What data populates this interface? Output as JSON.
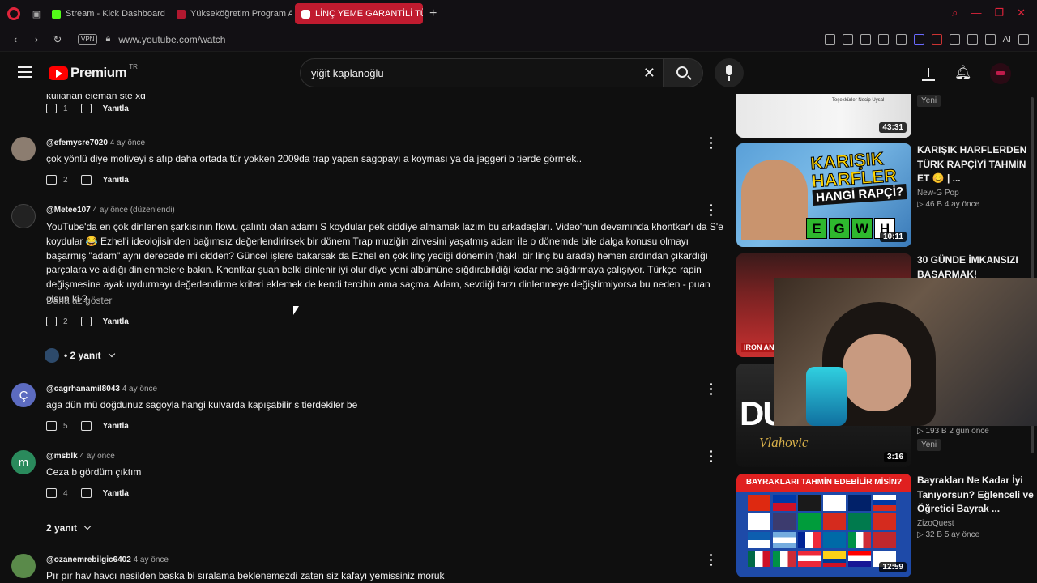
{
  "browser": {
    "tabs": [
      {
        "label": "Stream - Kick Dashboard",
        "fav_color": "#53fc18"
      },
      {
        "label": "Yükseköğretim Program Atlası",
        "fav_color": "#b1182f"
      },
      {
        "label": "LİNÇ YEME GARANTİLİ TÜRK",
        "fav_color": "#ffffff",
        "active": true
      }
    ],
    "url": "www.youtube.com/watch",
    "vpn": "VPN",
    "ai_label": "AI"
  },
  "header": {
    "logo_word": "Premium",
    "region": "TR",
    "search_value": "yiğit kaplanoğlu"
  },
  "comments": [
    {
      "tail_text": "kullanan eleman ste xd",
      "likes": "1",
      "reply": "Yanıtla"
    },
    {
      "handle": "@efemysre7020",
      "time": "4 ay önce",
      "text": "çok yönlü diye motiveyi s atıp daha ortada tür yokken 2009da trap yapan sagopayı a koyması ya da jaggeri b tierde görmek..",
      "likes": "2",
      "reply": "Yanıtla",
      "avatar_color": "#8c7d70",
      "avatar_letter": ""
    },
    {
      "handle": "@Metee107",
      "time": "4 ay önce (düzenlendi)",
      "text": "YouTube'da en çok dinlenen şarkısının flowu çalıntı olan adamı S koydular pek ciddiye almamak lazım bu arkadaşları. Video'nun devamında khontkar'ı da S'e koydular 😂 Ezhel'i ideolojisinden bağımsız değerlendirirsek bir dönem Trap muziğin zirvesini yaşatmış adam ile o dönemde bile dalga konusu olmayı başarmış \"adam\" aynı derecede mi cidden? Güncel işlere bakarsak da Ezhel  en çok linç yediği dönemin (haklı bir linç bu arada) hemen ardından çıkardığı parçalara ve aldığı dinlenmelere bakın. Khontkar şuan belki dinlenir iyi olur diye yeni albümüne sığdırabildiği kadar mc sığdırmaya çalışıyor. Türkçe rapin değişmesine ayak uydurmayı değerlendirme kriteri eklemek de kendi tercihin ama saçma. Adam, sevdiği tarzı dinlenmeye değiştirmiyorsa bu neden - puan olsun ki ?",
      "show_less": "Daha az göster",
      "likes": "2",
      "reply": "Yanıtla",
      "replies": "• 2 yanıt",
      "avatar_color": "#222",
      "avatar_letter": ""
    },
    {
      "handle": "@cagrhanamil8043",
      "time": "4 ay önce",
      "text": "aga dün mü doğdunuz sagoyla hangi kulvarda kapışabilir s tierdekiler be",
      "likes": "5",
      "reply": "Yanıtla",
      "avatar_color": "#5c6bc0",
      "avatar_letter": "Ç"
    },
    {
      "handle": "@msblk",
      "time": "4 ay önce",
      "text": "Ceza b gördüm çıktım",
      "likes": "4",
      "reply": "Yanıtla",
      "replies": "2 yanıt",
      "avatar_color": "#2a8a5c",
      "avatar_letter": "m"
    },
    {
      "handle": "@ozanemrebilgic6402",
      "time": "4 ay önce",
      "text": "Pır pır hav havcı nesilden baska bi sıralama beklenemezdi zaten siz kafayı yemissiniz moruk",
      "avatar_color": "#5a8a4a",
      "avatar_letter": ""
    }
  ],
  "sidebar": [
    {
      "thumb_text": "Teşekkürler Necip Uysal",
      "duration": "43:31",
      "badge": "Yeni"
    },
    {
      "title": "KARIŞIK HARFLERDEN TÜRK RAPÇİYİ TAHMİN ET 😊 | ...",
      "channel": "New-G Pop",
      "stats": "▷ 46 B  4 ay önce",
      "duration": "10:11",
      "thumb_title": "KARIŞIK HARFLER",
      "thumb_sub": "HANGİ RAPÇİ?",
      "letters": [
        "E",
        "G",
        "W",
        "H"
      ]
    },
    {
      "title": "30 GÜNDE İMKANSIZI BAŞARMAK!",
      "duration": ""
    },
    {
      "stats": "▷ 193 B  2 gün önce",
      "badge": "Yeni",
      "duration": "3:16",
      "thumb_title": "DUŠAN",
      "thumb_sub": "Vlahovic"
    },
    {
      "title": "Bayrakları Ne Kadar İyi Tanıyorsun? Eğlenceli ve Öğretici Bayrak ...",
      "channel": "ZizoQuest",
      "stats": "▷ 32 B  5 ay önce",
      "duration": "12:59",
      "thumb_title": "BAYRAKLARI TAHMİN EDEBİLİR MİSİN?"
    }
  ],
  "colors": {
    "accent": "#ff0000",
    "tab_active": "#c01b2f"
  }
}
